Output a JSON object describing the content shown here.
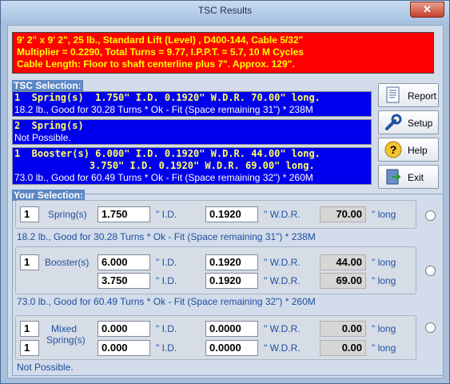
{
  "window": {
    "title": "TSC Results",
    "close_glyph": "✕"
  },
  "header_lines": [
    "9' 2\" x  9' 2\", 25 lb., Standard Lift (Level) , D400-144, Cable 5/32\"",
    "Multiplier = 0.2290, Total Turns = 9.77, I.P.P.T. = 5.7, 10 M Cycles",
    "Cable Length: Floor to shaft centerline plus 7\". Approx. 129\"."
  ],
  "tsc_selection": {
    "label": "TSC Selection:",
    "blocks": [
      {
        "lines": [
          "1  Spring(s)  1.750\" I.D. 0.1920\" W.D.R. 70.00\" long."
        ],
        "note": "18.2 lb., Good for 30.28 Turns * Ok - Fit (Space remaining 31\") * 238M"
      },
      {
        "lines": [
          "2  Spring(s)"
        ],
        "note": "Not Possible."
      },
      {
        "lines": [
          "1  Booster(s) 6.000\" I.D. 0.1920\" W.D.R. 44.00\" long.",
          "             3.750\" I.D. 0.1920\" W.D.R. 69.00\" long."
        ],
        "note": "73.0 lb., Good for 60.49 Turns * Ok - Fit (Space remaining 32\") * 260M"
      }
    ]
  },
  "buttons": {
    "report": {
      "label": "Report",
      "icon": "report-icon"
    },
    "setup": {
      "label": "Setup",
      "icon": "wrench-icon"
    },
    "help": {
      "label": "Help",
      "icon": "help-icon"
    },
    "exit": {
      "label": "Exit",
      "icon": "exit-door-icon"
    }
  },
  "your_selection": {
    "label": "Your Selection:",
    "units": {
      "id": "\" I.D.",
      "wdr": "\" W.D.R.",
      "long": "\" long"
    },
    "single": {
      "count": "1",
      "type_label": "Spring(s)",
      "id": "1.750",
      "wdr": "0.1920",
      "length": "70.00",
      "status": "18.2 lb., Good for 30.28 Turns * Ok - Fit (Space remaining 31\") * 238M"
    },
    "booster": {
      "count": "1",
      "type_label": "Booster(s)",
      "rows": [
        {
          "id": "6.000",
          "wdr": "0.1920",
          "length": "44.00"
        },
        {
          "id": "3.750",
          "wdr": "0.1920",
          "length": "69.00"
        }
      ],
      "status": "73.0 lb., Good for 60.49 Turns * Ok - Fit (Space remaining 32\") * 260M"
    },
    "mixed": {
      "counts": [
        "1",
        "1"
      ],
      "type_label_1": "Mixed",
      "type_label_2": "Spring(s)",
      "rows": [
        {
          "id": "0.000",
          "wdr": "0.0000",
          "length": "0.00"
        },
        {
          "id": "0.000",
          "wdr": "0.0000",
          "length": "0.00"
        }
      ],
      "status": "Not Possible."
    }
  }
}
